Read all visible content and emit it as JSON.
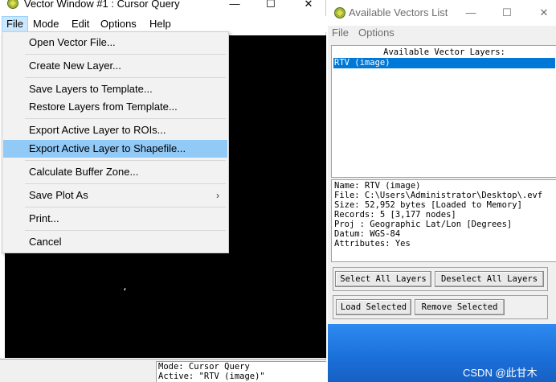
{
  "left_window": {
    "title": "Vector Window #1 : Cursor Query",
    "controls": {
      "minimize": "—",
      "maximize": "☐",
      "close": "✕"
    },
    "menubar": [
      "File",
      "Mode",
      "Edit",
      "Options",
      "Help"
    ],
    "file_menu": [
      {
        "label": "Open Vector File..."
      },
      {
        "label": "Create New Layer..."
      },
      {
        "label": "Save Layers to Template..."
      },
      {
        "label": "Restore Layers from Template..."
      },
      {
        "label": "Export Active Layer to ROIs..."
      },
      {
        "label": "Export Active Layer to Shapefile..."
      },
      {
        "label": "Calculate Buffer Zone..."
      },
      {
        "label": "Save Plot As",
        "submenu_arrow": "›"
      },
      {
        "label": "Print..."
      },
      {
        "label": "Cancel"
      }
    ],
    "plot_cursor_mark": "‘",
    "status": {
      "mode_line": "Mode: Cursor Query",
      "active_line": "Active: \"RTV (image)\""
    }
  },
  "right_window": {
    "title": "Available Vectors List",
    "controls": {
      "minimize": "—",
      "maximize": "☐",
      "close": "✕"
    },
    "menubar": [
      "File",
      "Options"
    ],
    "list_header": "Available Vector Layers:",
    "layers": [
      "RTV (image)"
    ],
    "info": {
      "name": "Name: RTV (image)",
      "file": "File: C:\\Users\\Administrator\\Desktop\\.evf",
      "size": "Size: 52,952 bytes [Loaded to Memory]",
      "records": "Records: 5 [3,177 nodes]",
      "proj": "Proj : Geographic Lat/Lon [Degrees]",
      "datum": "Datum: WGS-84",
      "attributes": "Attributes: Yes"
    },
    "buttons": {
      "select_all": "Select All Layers",
      "deselect_all": "Deselect All Layers",
      "load_selected": "Load Selected",
      "remove_selected": "Remove Selected"
    }
  },
  "watermark": "CSDN @此甘木",
  "colors": {
    "menu_highlight": "#91c9f7",
    "list_selection": "#0078d7",
    "plot_background": "#000000",
    "desktop_blue": "#1a6fd8"
  }
}
